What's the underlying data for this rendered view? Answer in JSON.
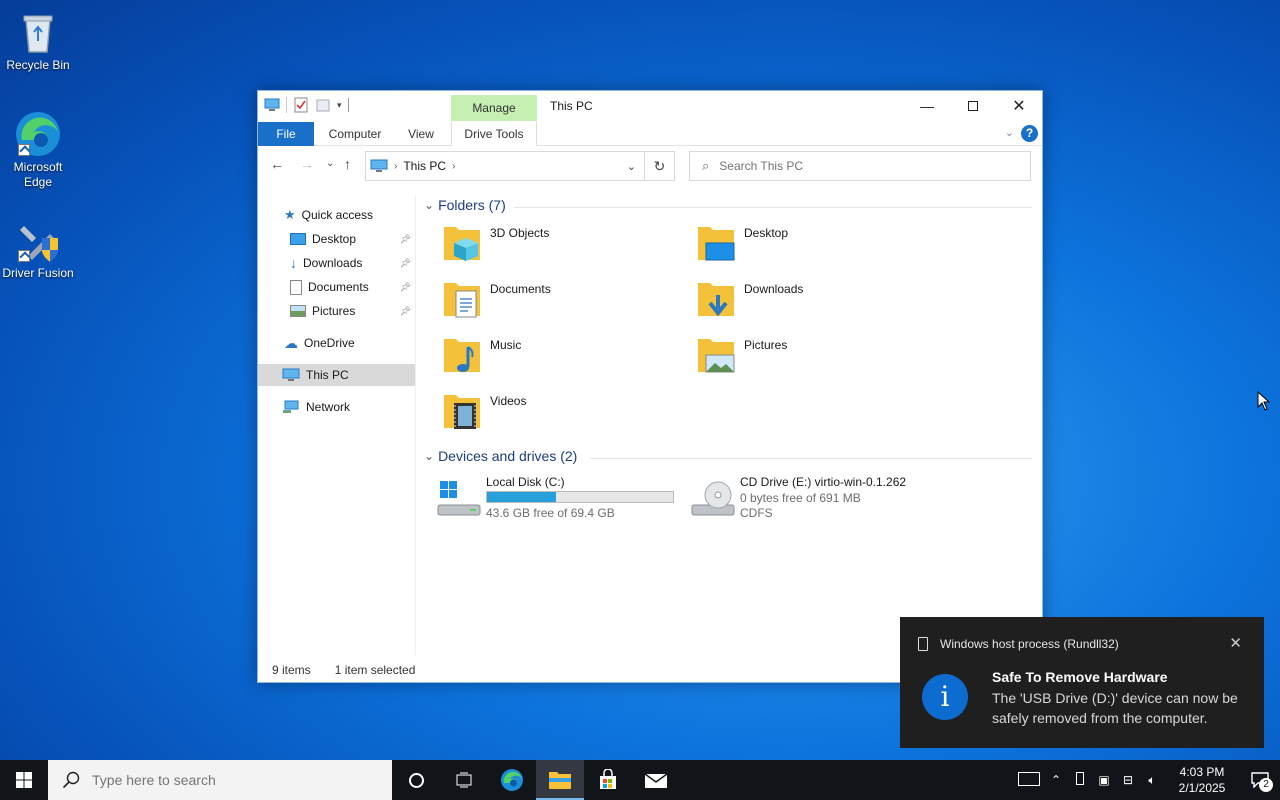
{
  "desktop": {
    "icons": [
      {
        "label": "Recycle Bin"
      },
      {
        "label": "Microsoft Edge"
      },
      {
        "label": "Driver Fusion"
      }
    ]
  },
  "window": {
    "title": "This PC",
    "manage_tab": "Manage",
    "ribbon_tabs": {
      "file": "File",
      "computer": "Computer",
      "view": "View",
      "drive_tools": "Drive Tools"
    },
    "help": "?",
    "address": {
      "location": "This PC"
    },
    "search": {
      "placeholder": "Search This PC"
    },
    "nav": {
      "quick_access": "Quick access",
      "desktop": "Desktop",
      "downloads": "Downloads",
      "documents": "Documents",
      "pictures": "Pictures",
      "onedrive": "OneDrive",
      "this_pc": "This PC",
      "network": "Network"
    },
    "folders_header": "Folders (7)",
    "folders": [
      {
        "label": "3D Objects"
      },
      {
        "label": "Desktop"
      },
      {
        "label": "Documents"
      },
      {
        "label": "Downloads"
      },
      {
        "label": "Music"
      },
      {
        "label": "Pictures"
      },
      {
        "label": "Videos"
      }
    ],
    "drives_header": "Devices and drives (2)",
    "drives": [
      {
        "name": "Local Disk (C:)",
        "free_text": "43.6 GB free of 69.4 GB",
        "used_fraction": 0.37
      },
      {
        "name": "CD Drive (E:) virtio-win-0.1.262",
        "free_text": "0 bytes free of 691 MB",
        "fs": "CDFS"
      }
    ],
    "status": {
      "items": "9 items",
      "selected": "1 item selected"
    }
  },
  "toast": {
    "app": "Windows host process (Rundll32)",
    "title": "Safe To Remove Hardware",
    "message": "The 'USB Drive (D:)' device can now be safely removed from the computer."
  },
  "taskbar": {
    "search_placeholder": "Type here to search",
    "time": "4:03 PM",
    "date": "2/1/2025",
    "notification_count": "2"
  },
  "colors": {
    "accent": "#1a6fc8",
    "folder": "#f3c13a",
    "manage_tab": "#c6efb2",
    "drive_bar": "#26a0da"
  }
}
